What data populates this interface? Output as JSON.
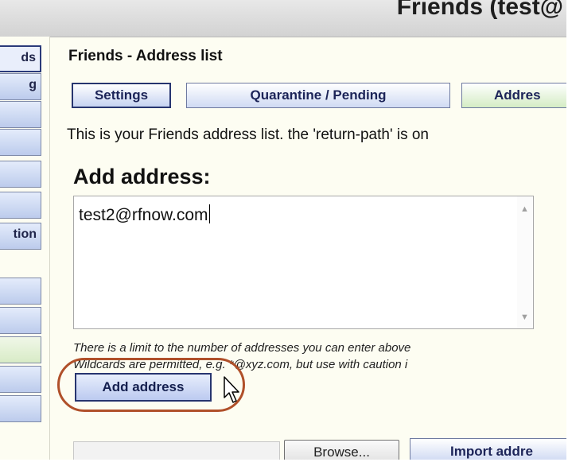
{
  "window": {
    "title": "Friends (test@"
  },
  "sidebar": {
    "items": [
      {
        "label": "ds",
        "active": true
      },
      {
        "label": "g"
      },
      {
        "label": ""
      },
      {
        "label": ""
      },
      {
        "label": ""
      },
      {
        "label": ""
      },
      {
        "label": "tion"
      },
      {
        "label": ""
      },
      {
        "label": ""
      },
      {
        "label": "",
        "green": true
      },
      {
        "label": ""
      },
      {
        "label": ""
      }
    ]
  },
  "main": {
    "heading": "Friends - Address list",
    "tabs": [
      {
        "label": "Settings",
        "active": true
      },
      {
        "label": "Quarantine / Pending"
      },
      {
        "label": "Addres",
        "green": true
      }
    ],
    "description": "This is your Friends address list. the 'return-path' is on",
    "add_section": {
      "title": "Add address:",
      "textarea_value": "test2@rfnow.com",
      "note_line1": "There is a limit to the number of addresses you can enter above",
      "note_line2": "Wildcards are permitted, e.g. *@xyz.com, but use with caution i",
      "button_label": "Add address"
    },
    "import": {
      "browse_label": "Browse...",
      "import_label": "Import addre"
    }
  },
  "colors": {
    "page_bg": "#fdfdf2",
    "button_blue": "#c6d3f1",
    "button_green": "#d4ecc4",
    "highlight": "#b0502a"
  }
}
